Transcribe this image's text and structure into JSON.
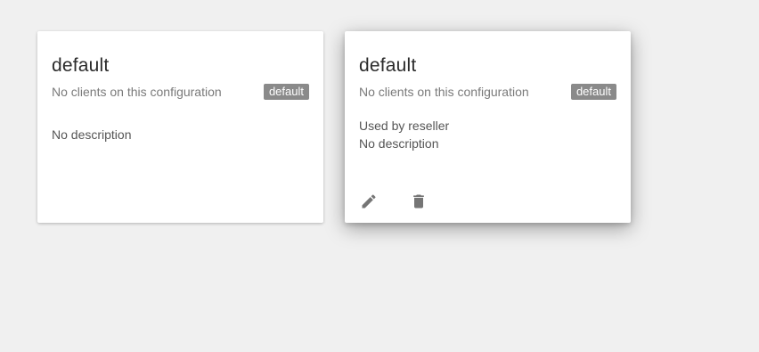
{
  "cards": [
    {
      "title": "default",
      "subtitle": "No clients on this configuration",
      "badge": "default",
      "description": "No description"
    },
    {
      "title": "default",
      "subtitle": "No clients on this configuration",
      "badge": "default",
      "used_by": "Used by reseller",
      "description": "No description",
      "actions": [
        {
          "icon": "pencil-icon",
          "name": "edit-button"
        },
        {
          "icon": "trash-icon",
          "name": "delete-button"
        }
      ]
    }
  ],
  "colors": {
    "background": "#f0f0f0",
    "card": "#ffffff",
    "badge": "#8a8a8a",
    "icon": "#757575"
  }
}
